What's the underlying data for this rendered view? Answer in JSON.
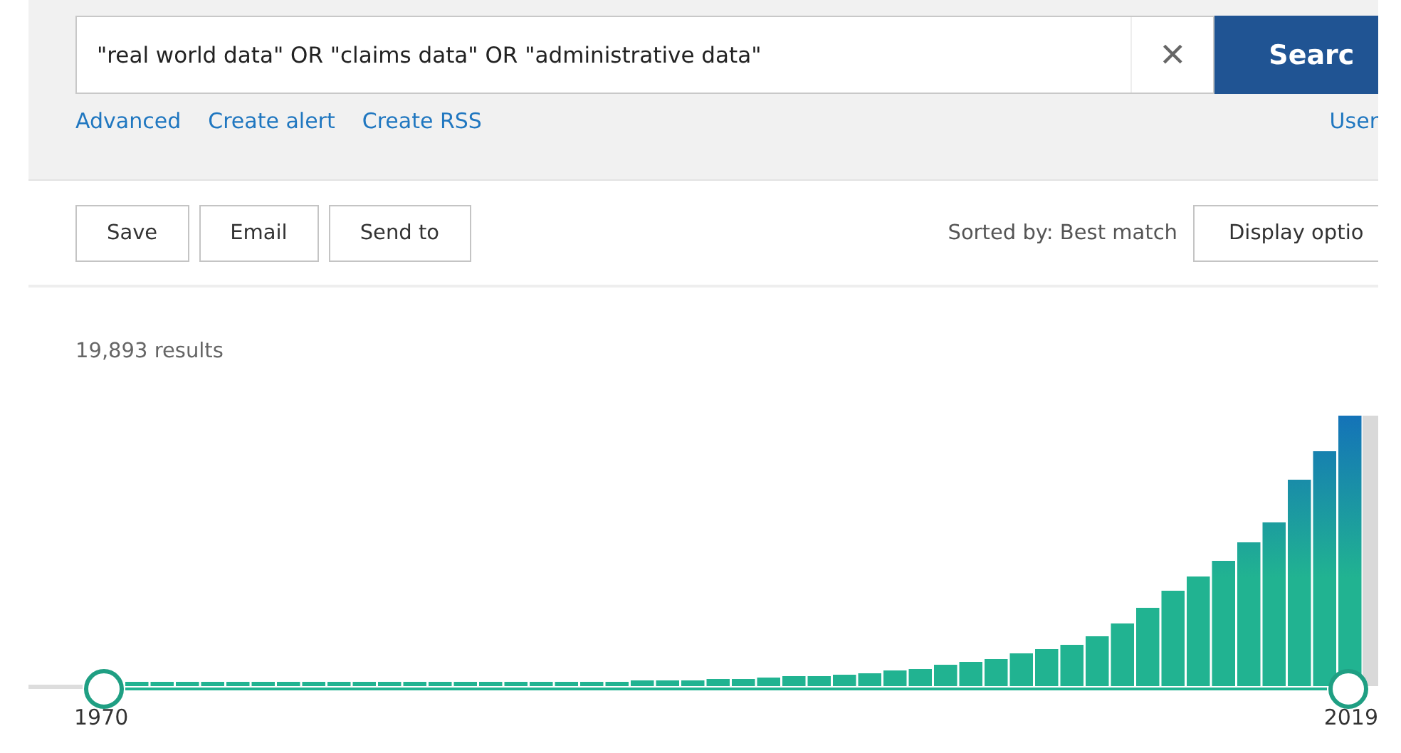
{
  "search": {
    "value": "\"real world data\" OR \"claims data\" OR \"administrative data\"",
    "clear_label": "×",
    "button": "Searc"
  },
  "links": [
    "Advanced",
    "Create alert",
    "Create RSS"
  ],
  "right_link": "User",
  "actions": [
    "Save",
    "Email",
    "Send to"
  ],
  "sort": "Sorted by: Best match",
  "display_button": "Display optio",
  "results": "19,893 results",
  "timeline": {
    "kind": "picture",
    "start": "1970",
    "end": "2019"
  }
}
